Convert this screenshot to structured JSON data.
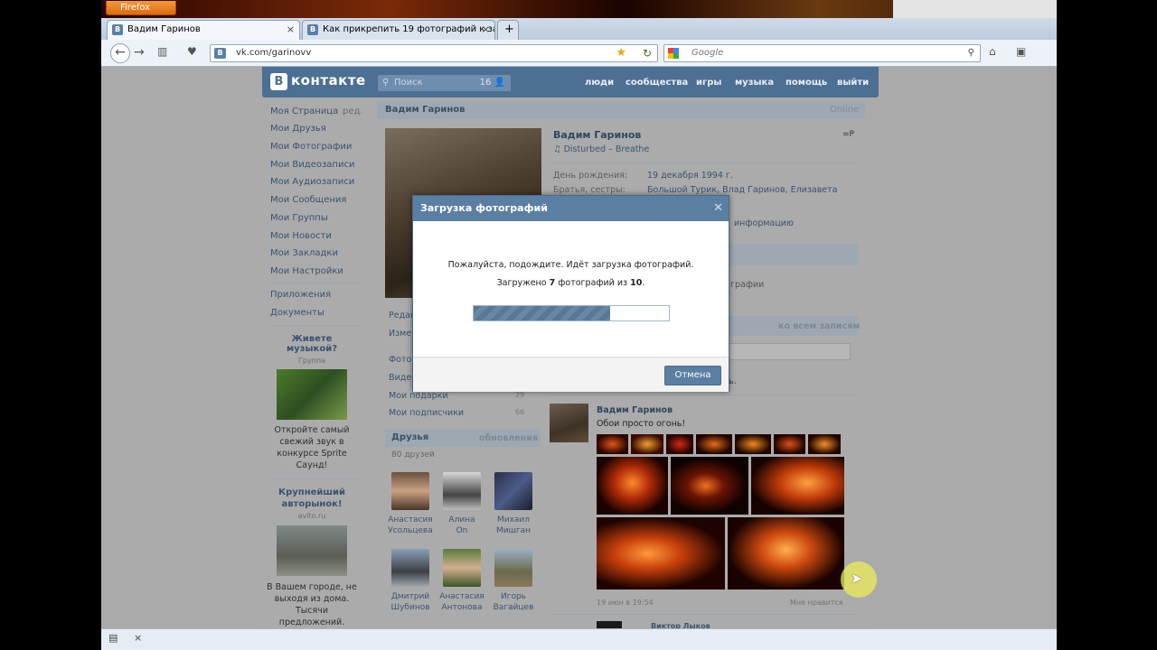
{
  "browser": {
    "app_button": "Firefox",
    "tabs": [
      {
        "label": "Вадим Гаринов",
        "active": true
      },
      {
        "label": "Как прикрепить 19 фотографий к за...",
        "active": false
      }
    ],
    "new_tab": "+",
    "url": "vk.com/garinovv",
    "search_placeholder": "Google"
  },
  "vk": {
    "logo_letter": "B",
    "logo_text": "контакте",
    "search_placeholder": "Поиск",
    "search_count": "16",
    "top_nav": [
      "люди",
      "сообщества",
      "игры",
      "музыка",
      "помощь",
      "выйти"
    ],
    "left_menu": [
      "Моя Страница",
      "Мои Друзья",
      "Мои Фотографии",
      "Мои Видеозаписи",
      "Мои Аудиозаписи",
      "Мои Сообщения",
      "Мои Группы",
      "Мои Новости",
      "Мои Закладки",
      "Мои Настройки"
    ],
    "edit_link": "ред.",
    "left_menu_2": [
      "Приложения",
      "Документы"
    ],
    "ad1": {
      "title": "Живете музыкой?",
      "subtitle": "Группа",
      "text": "Откройте самый свежий звук в конкурсе Sprite Саунд!"
    },
    "ad2": {
      "title": "Крупнейший авторынок!",
      "subtitle": "avito.ru",
      "text": "В Вашем городе, не выходя из дома. Тысячи предложений."
    }
  },
  "profile": {
    "header_name": "Вадим Гаринов",
    "header_status": "Online",
    "name": "Вадим Гаринов",
    "song": "Disturbed – Breathe",
    "status_tag": "=P",
    "birthday_label": "День рождения:",
    "birthday_value": "19 декабря 1994 г.",
    "siblings_label": "Братья, сестры:",
    "siblings_value": "Большой Турик, Влад Гаринов, Елизавета",
    "more_info": "информацию",
    "photos_word": "графии",
    "wall_filter": "ко всем записям",
    "wall_hint": "ь.",
    "side_links_partial": [
      "Редак",
      "Измен",
      "Фото",
      "Видео"
    ],
    "side_links": [
      {
        "label": "Мои подарки",
        "count": "29"
      },
      {
        "label": "Мои подписчики",
        "count": "66"
      }
    ],
    "friends_title": "Друзья",
    "friends_updates": "обновления",
    "friends_count": "80 друзей",
    "friends": [
      {
        "first": "Анастасия",
        "last": "Усольцева"
      },
      {
        "first": "Алина",
        "last": "On"
      },
      {
        "first": "Михаил",
        "last": "Мишган"
      },
      {
        "first": "Дмитрий",
        "last": "Шубинов"
      },
      {
        "first": "Анастасия",
        "last": "Антонова"
      },
      {
        "first": "Игорь",
        "last": "Вагайцев"
      }
    ],
    "post_author": "Вадим Гаринов",
    "post_text": "Обои просто огонь!",
    "post_date": "19 июн в 19:54",
    "post_like": "Мне нравится",
    "next_author": "Виктор Лыков"
  },
  "modal": {
    "title": "Загрузка фотографий",
    "close": "✕",
    "message": "Пожалуйста, подождите. Идёт загрузка фотографий.",
    "progress_prefix": "Загружено",
    "progress_done": "7",
    "progress_mid": "фотографий из",
    "progress_total": "10",
    "progress_suffix": ".",
    "progress_fraction": 0.7,
    "cancel_label": "Отмена"
  },
  "colors": {
    "vk_blue": "#4d6f94",
    "modal_head": "#5b7ea3",
    "progress": "#5a7896"
  }
}
